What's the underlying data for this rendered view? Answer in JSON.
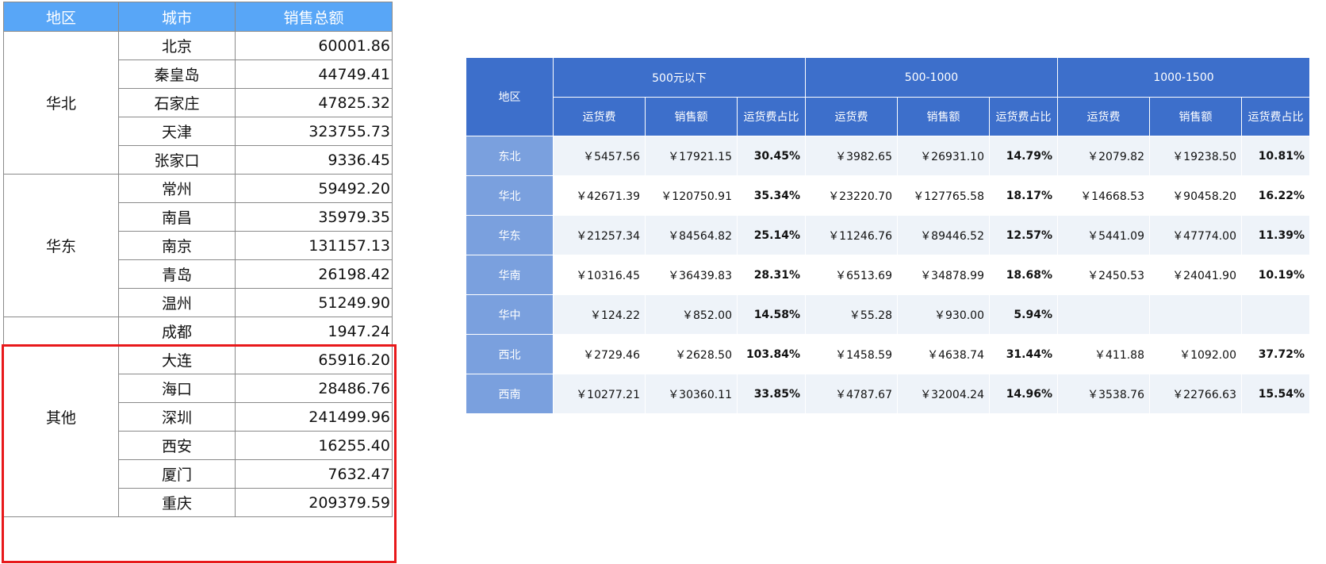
{
  "left": {
    "headers": [
      "地区",
      "城市",
      "销售总额"
    ],
    "groups": [
      {
        "region": "华北",
        "rows": [
          {
            "city": "北京",
            "amount": "60001.86"
          },
          {
            "city": "秦皇岛",
            "amount": "44749.41"
          },
          {
            "city": "石家庄",
            "amount": "47825.32"
          },
          {
            "city": "天津",
            "amount": "323755.73"
          },
          {
            "city": "张家口",
            "amount": "9336.45"
          }
        ]
      },
      {
        "region": "华东",
        "rows": [
          {
            "city": "常州",
            "amount": "59492.20"
          },
          {
            "city": "南昌",
            "amount": "35979.35"
          },
          {
            "city": "南京",
            "amount": "131157.13"
          },
          {
            "city": "青岛",
            "amount": "26198.42"
          },
          {
            "city": "温州",
            "amount": "51249.90"
          }
        ]
      },
      {
        "region": "其他",
        "rows": [
          {
            "city": "成都",
            "amount": "1947.24"
          },
          {
            "city": "大连",
            "amount": "65916.20"
          },
          {
            "city": "海口",
            "amount": "28486.76"
          },
          {
            "city": "深圳",
            "amount": "241499.96"
          },
          {
            "city": "西安",
            "amount": "16255.40"
          },
          {
            "city": "厦门",
            "amount": "7632.47"
          },
          {
            "city": "重庆",
            "amount": "209379.59"
          }
        ]
      }
    ]
  },
  "right": {
    "region_header": "地区",
    "groups": [
      "500元以下",
      "500-1000",
      "1000-1500"
    ],
    "sub_headers": [
      "运货费",
      "销售额",
      "运货费占比"
    ],
    "rows": [
      {
        "region": "东北",
        "cells": [
          "￥5457.56",
          "￥17921.15",
          "30.45%",
          "￥3982.65",
          "￥26931.10",
          "14.79%",
          "￥2079.82",
          "￥19238.50",
          "10.81%"
        ]
      },
      {
        "region": "华北",
        "cells": [
          "￥42671.39",
          "￥120750.91",
          "35.34%",
          "￥23220.70",
          "￥127765.58",
          "18.17%",
          "￥14668.53",
          "￥90458.20",
          "16.22%"
        ]
      },
      {
        "region": "华东",
        "cells": [
          "￥21257.34",
          "￥84564.82",
          "25.14%",
          "￥11246.76",
          "￥89446.52",
          "12.57%",
          "￥5441.09",
          "￥47774.00",
          "11.39%"
        ]
      },
      {
        "region": "华南",
        "cells": [
          "￥10316.45",
          "￥36439.83",
          "28.31%",
          "￥6513.69",
          "￥34878.99",
          "18.68%",
          "￥2450.53",
          "￥24041.90",
          "10.19%"
        ]
      },
      {
        "region": "华中",
        "cells": [
          "￥124.22",
          "￥852.00",
          "14.58%",
          "￥55.28",
          "￥930.00",
          "5.94%",
          "",
          "",
          ""
        ]
      },
      {
        "region": "西北",
        "cells": [
          "￥2729.46",
          "￥2628.50",
          "103.84%",
          "￥1458.59",
          "￥4638.74",
          "31.44%",
          "￥411.88",
          "￥1092.00",
          "37.72%"
        ]
      },
      {
        "region": "西南",
        "cells": [
          "￥10277.21",
          "￥30360.11",
          "33.85%",
          "￥4787.67",
          "￥32004.24",
          "14.96%",
          "￥3538.76",
          "￥22766.63",
          "15.54%"
        ]
      }
    ]
  },
  "colors": {
    "left_header_bg": "#58a6f7",
    "right_header_bg": "#3d6fcb",
    "right_region_bg": "#7aa0de",
    "stripe_bg": "#eef3f9",
    "highlight_border": "#e8191b"
  }
}
